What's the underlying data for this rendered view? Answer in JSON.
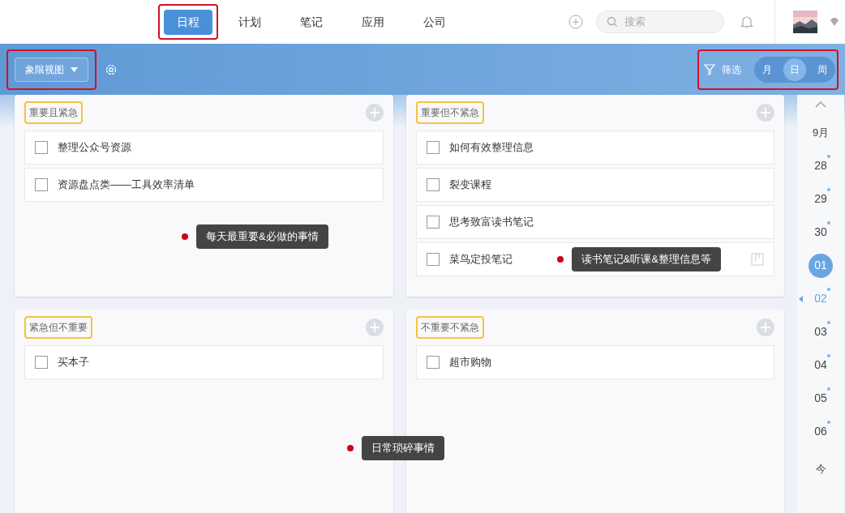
{
  "nav": {
    "tabs": [
      {
        "label": "日程",
        "selected": true
      },
      {
        "label": "计划",
        "selected": false
      },
      {
        "label": "笔记",
        "selected": false
      },
      {
        "label": "应用",
        "selected": false
      },
      {
        "label": "公司",
        "selected": false
      }
    ],
    "search": {
      "placeholder": "搜索"
    }
  },
  "toolbar": {
    "view_button": "象限视图",
    "filter": "筛选",
    "modes": [
      {
        "label": "月",
        "selected": false
      },
      {
        "label": "日",
        "selected": true
      },
      {
        "label": "周",
        "selected": false
      }
    ]
  },
  "quadrants": [
    {
      "title": "重要且紧急",
      "tasks": [
        {
          "text": "整理公众号资源",
          "checked": false,
          "hovered": false
        },
        {
          "text": "资源盘点类——工具效率清单",
          "checked": false,
          "hovered": false
        }
      ],
      "note": "每天最重要&必做的事情"
    },
    {
      "title": "重要但不紧急",
      "tasks": [
        {
          "text": "如何有效整理信息",
          "checked": false,
          "hovered": false
        },
        {
          "text": "裂变课程",
          "checked": false,
          "hovered": false
        },
        {
          "text": "思考致富读书笔记",
          "checked": false,
          "hovered": false
        },
        {
          "text": "菜鸟定投笔记",
          "checked": false,
          "hovered": true
        }
      ],
      "note": "读书笔记&听课&整理信息等"
    },
    {
      "title": "紧急但不重要",
      "tasks": [
        {
          "text": "买本子",
          "checked": false,
          "hovered": false
        }
      ],
      "note": "日常琐碎事情"
    },
    {
      "title": "不重要不紧急",
      "tasks": [
        {
          "text": "超市购物",
          "checked": false,
          "hovered": false
        }
      ]
    }
  ],
  "dates": [
    {
      "label": "9月",
      "kind": "month",
      "selected": false,
      "today": false,
      "has_events": false
    },
    {
      "label": "28",
      "kind": "day",
      "selected": false,
      "today": false,
      "has_events": true
    },
    {
      "label": "29",
      "kind": "day",
      "selected": false,
      "today": false,
      "has_events": true
    },
    {
      "label": "30",
      "kind": "day",
      "selected": false,
      "today": false,
      "has_events": true
    },
    {
      "label": "01",
      "kind": "day",
      "selected": true,
      "today": false,
      "has_events": false
    },
    {
      "label": "02",
      "kind": "day",
      "selected": false,
      "today": true,
      "has_events": true
    },
    {
      "label": "03",
      "kind": "day",
      "selected": false,
      "today": false,
      "has_events": true
    },
    {
      "label": "04",
      "kind": "day",
      "selected": false,
      "today": false,
      "has_events": true
    },
    {
      "label": "05",
      "kind": "day",
      "selected": false,
      "today": false,
      "has_events": true
    },
    {
      "label": "06",
      "kind": "day",
      "selected": false,
      "today": false,
      "has_events": true
    },
    {
      "label": "今",
      "kind": "jump",
      "selected": false,
      "today": false,
      "has_events": false
    }
  ]
}
